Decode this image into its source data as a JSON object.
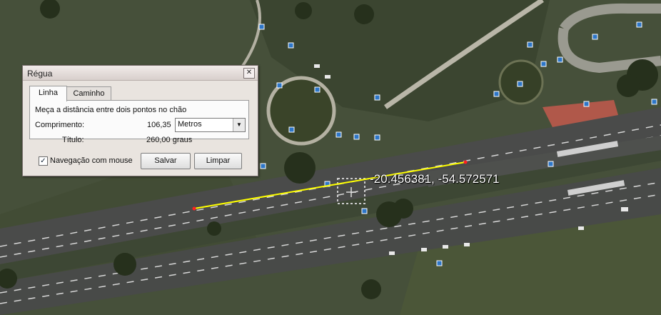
{
  "ruler": {
    "title": "Régua",
    "close_icon": "close-icon",
    "tabs": [
      "Linha",
      "Caminho"
    ],
    "active_tab": "Linha",
    "description": "Meça a distância entre dois pontos no chão",
    "length_label": "Comprimento:",
    "length_value": "106,35",
    "unit_selected": "Metros",
    "heading_label": "Título:",
    "heading_value": "260,00 graus",
    "mouse_nav_label": "Navegação com mouse",
    "mouse_nav_checked": true,
    "save_label": "Salvar",
    "clear_label": "Limpar"
  },
  "map": {
    "coordinates": "-20.456381, -54.572571",
    "measure_line_color": "#ffff00",
    "endpoint_color": "#ff2020"
  }
}
